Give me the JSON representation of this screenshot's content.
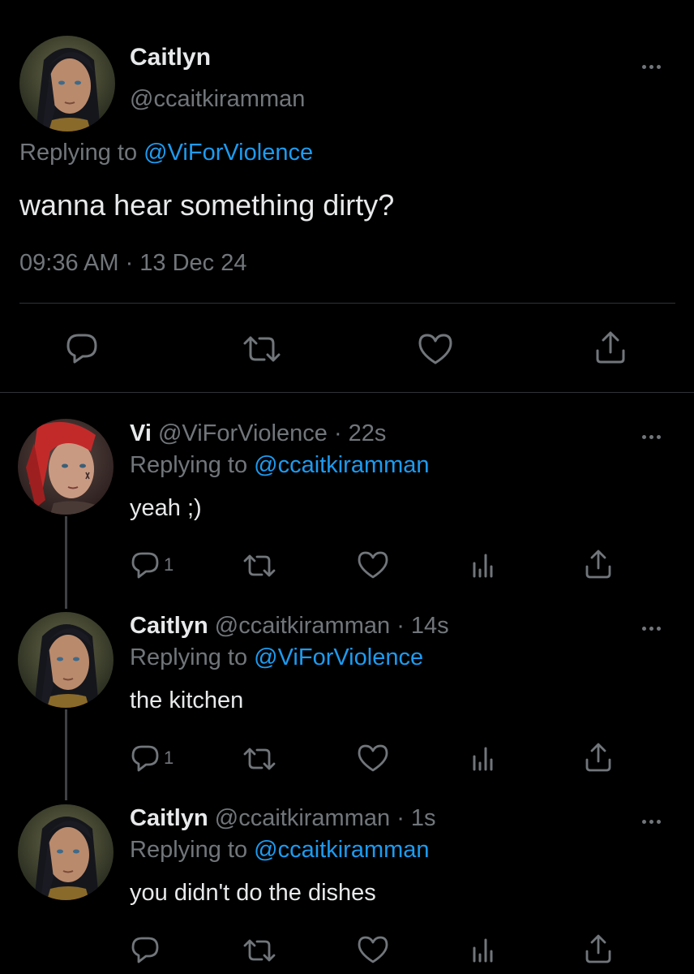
{
  "main_tweet": {
    "name": "Caitlyn",
    "handle": "@ccaitkiramman",
    "replying_prefix": "Replying to ",
    "replying_to": "@ViForViolence",
    "text": "wanna hear something dirty?",
    "timestamp": "09:36 AM · 13 Dec 24"
  },
  "replies": [
    {
      "name": "Vi",
      "handle": "@ViForViolence",
      "time": "· 22s",
      "replying_prefix": "Replying to ",
      "replying_to": "@ccaitkiramman",
      "text": "yeah ;)",
      "reply_count": "1"
    },
    {
      "name": "Caitlyn",
      "handle": "@ccaitkiramman",
      "time": "· 14s",
      "replying_prefix": "Replying to ",
      "replying_to": "@ViForViolence",
      "text": "the kitchen",
      "reply_count": "1"
    },
    {
      "name": "Caitlyn",
      "handle": "@ccaitkiramman",
      "time": "· 1s",
      "replying_prefix": "Replying to ",
      "replying_to": "@ccaitkiramman",
      "text": "you didn't do the dishes",
      "reply_count": ""
    }
  ],
  "colors": {
    "background": "#000000",
    "text": "#e7e9ea",
    "muted": "#71767b",
    "link": "#1d9bf0",
    "divider": "#2f3336"
  },
  "icons": {
    "reply": "reply-icon",
    "retweet": "retweet-icon",
    "like": "heart-icon",
    "views": "views-icon",
    "share": "share-icon",
    "more": "more-icon"
  }
}
